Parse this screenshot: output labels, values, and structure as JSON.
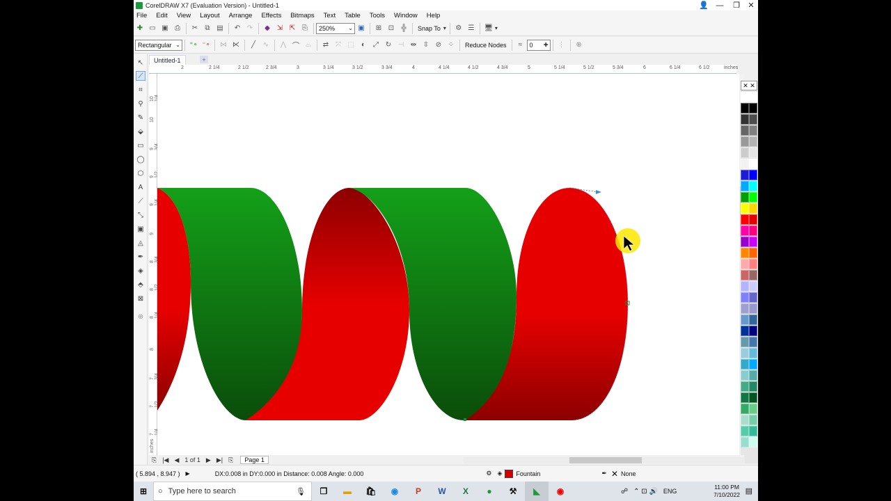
{
  "window": {
    "title": "CorelDRAW X7 (Evaluation Version) - Untitled-1",
    "minimize": "—",
    "maximize": "❐",
    "close": "✕"
  },
  "menu": [
    "File",
    "Edit",
    "View",
    "Layout",
    "Arrange",
    "Effects",
    "Bitmaps",
    "Text",
    "Table",
    "Tools",
    "Window",
    "Help"
  ],
  "toolbar": {
    "zoom": "250%",
    "snap_to": "Snap To"
  },
  "property_bar": {
    "selection_mode": "Rectangular",
    "reduce_nodes": "Reduce Nodes",
    "smoothness": "0"
  },
  "document": {
    "tab": "Untitled-1",
    "add_tab": "+"
  },
  "ruler": {
    "h_labels": [
      "2",
      "2 1/4",
      "2 1/2",
      "2 3/4",
      "3",
      "3 1/4",
      "3 1/2",
      "3 3/4",
      "4",
      "4 1/4",
      "4 1/2",
      "4 3/4",
      "5",
      "5 1/4",
      "5 1/2",
      "5 3/4",
      "6",
      "6 1/4",
      "6 1/2",
      "inches"
    ],
    "v_labels": [
      "10 1/4",
      "10",
      "9 3/4",
      "9 1/2",
      "9 1/4",
      "9",
      "8 3/4",
      "8 1/2",
      "8 1/4",
      "8",
      "7 3/4",
      "7 1/2",
      "7 1/4",
      "inches"
    ]
  },
  "pages": {
    "counter": "1 of 1",
    "page_tab": "Page 1"
  },
  "status": {
    "cursor_position": "( 5.894 , 8.947 )",
    "info": "DX:0.008 in DY:0.000 in Distance: 0.008 Angle: 0.000",
    "fill_type": "Fountain",
    "outline": "None"
  },
  "taskbar": {
    "search_placeholder": "Type here to search",
    "language": "ENG",
    "time": "11:00 PM",
    "date": "7/10/2022"
  },
  "colors": {
    "red": "#e60000",
    "dark_red": "#8c0000",
    "green": "#14a019",
    "dark_green": "#0a4d0a"
  }
}
